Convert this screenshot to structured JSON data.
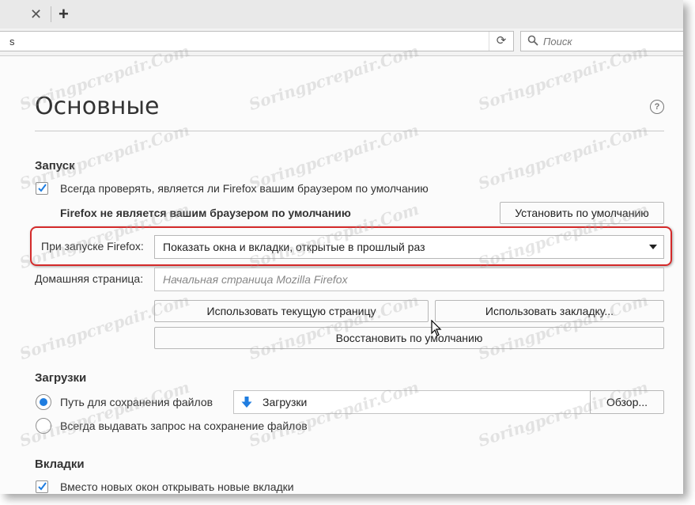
{
  "browser": {
    "url_text": "s",
    "search_placeholder": "Поиск"
  },
  "page": {
    "title": "Основные",
    "help_symbol": "?"
  },
  "startup": {
    "heading": "Запуск",
    "always_check_label": "Всегда проверять, является ли Firefox вашим браузером по умолчанию",
    "always_check_checked": true,
    "not_default_message": "Firefox не является вашим браузером по умолчанию",
    "set_default_button": "Установить по умолчанию",
    "on_startup_label": "При запуске Firefox:",
    "on_startup_value": "Показать окна и вкладки, открытые в прошлый раз",
    "homepage_label": "Домашняя страница:",
    "homepage_placeholder": "Начальная страница Mozilla Firefox",
    "use_current_button": "Использовать текущую страницу",
    "use_bookmark_button": "Использовать закладку...",
    "restore_default_button": "Восстановить по умолчанию"
  },
  "downloads": {
    "heading": "Загрузки",
    "save_path_label": "Путь для сохранения файлов",
    "save_path_selected": true,
    "folder_value": "Загрузки",
    "browse_button": "Обзор...",
    "always_ask_label": "Всегда выдавать запрос на сохранение файлов"
  },
  "tabs": {
    "heading": "Вкладки",
    "open_in_tabs_label": "Вместо новых окон открывать новые вкладки",
    "open_in_tabs_checked": true
  },
  "watermark": "Soringpcrepair.Com",
  "colors": {
    "accent": "#1f7de0",
    "highlight": "#d42a2a"
  }
}
